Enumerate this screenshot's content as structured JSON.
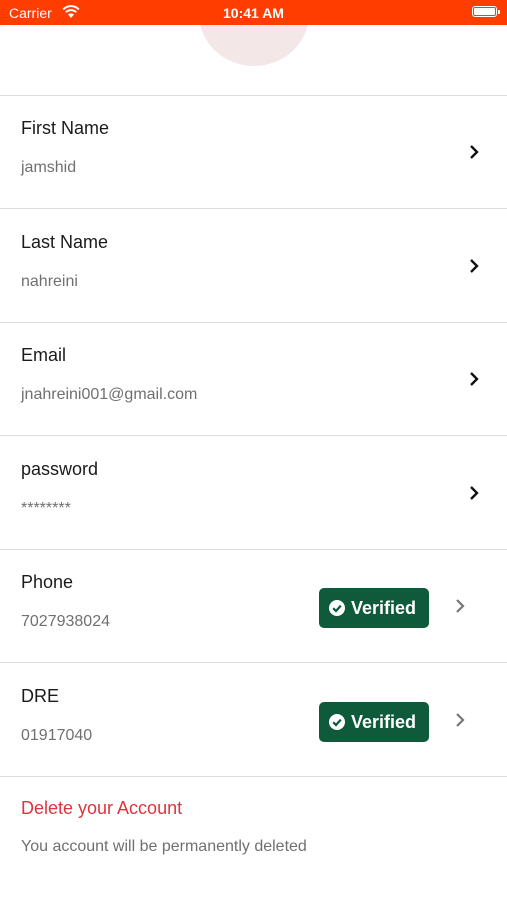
{
  "status_bar": {
    "carrier": "Carrier",
    "time": "10:41 AM"
  },
  "profile": {
    "avatar_icon": "laptop-icon",
    "fields": [
      {
        "label": "First Name",
        "value": "jamshid"
      },
      {
        "label": "Last Name",
        "value": "nahreini"
      },
      {
        "label": "Email",
        "value": "jnahreini001@gmail.com"
      },
      {
        "label": "password",
        "value": "********"
      },
      {
        "label": "Phone",
        "value": "7027938024",
        "badge": "Verified"
      },
      {
        "label": "DRE",
        "value": "01917040",
        "badge": "Verified"
      }
    ]
  },
  "delete_account": {
    "title": "Delete your Account",
    "description": "You account will be permanently deleted"
  },
  "colors": {
    "status_bar": "#FF3D00",
    "verified_badge": "#0E5A3A",
    "delete_text": "#E0333F"
  }
}
